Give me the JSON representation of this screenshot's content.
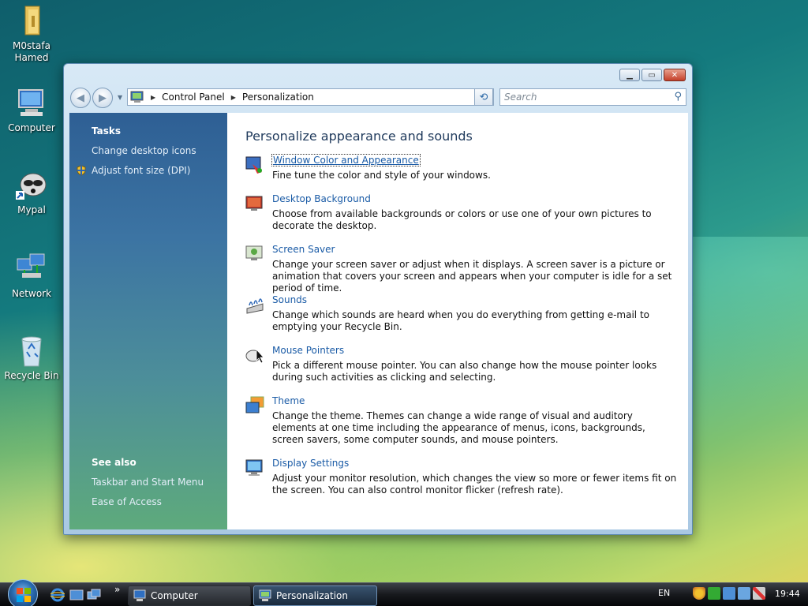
{
  "desktop": {
    "icons": [
      {
        "label": "M0stafa\nHamed",
        "icon": "folder-icon"
      },
      {
        "label": "Computer",
        "icon": "computer-icon"
      },
      {
        "label": "Mypal",
        "icon": "raccoon-shortcut-icon"
      },
      {
        "label": "Network",
        "icon": "network-icon"
      },
      {
        "label": "Recycle Bin",
        "icon": "recycle-bin-icon"
      }
    ]
  },
  "window": {
    "breadcrumb": [
      "Control Panel",
      "Personalization"
    ],
    "search_placeholder": "Search",
    "left_panel": {
      "tasks_heading": "Tasks",
      "tasks": [
        "Change desktop icons",
        "Adjust font size (DPI)"
      ],
      "see_also_heading": "See also",
      "see_also": [
        "Taskbar and Start Menu",
        "Ease of Access"
      ]
    },
    "main": {
      "heading": "Personalize appearance and sounds",
      "items": [
        {
          "title": "Window Color and Appearance",
          "desc": "Fine tune the color and style of your windows.",
          "icon": "window-color-icon"
        },
        {
          "title": "Desktop Background",
          "desc": "Choose from available backgrounds or colors or use one of your own pictures to decorate the desktop.",
          "icon": "desktop-background-icon"
        },
        {
          "title": "Screen Saver",
          "desc": "Change your screen saver or adjust when it displays. A screen saver is a picture or animation that covers your screen and appears when your computer is idle for a set period of time.",
          "icon": "screen-saver-icon"
        },
        {
          "title": "Sounds",
          "desc": "Change which sounds are heard when you do everything from getting e-mail to emptying your Recycle Bin.",
          "icon": "sounds-icon"
        },
        {
          "title": "Mouse Pointers",
          "desc": "Pick a different mouse pointer. You can also change how the mouse pointer looks during such activities as clicking and selecting.",
          "icon": "mouse-icon"
        },
        {
          "title": "Theme",
          "desc": "Change the theme. Themes can change a wide range of visual and auditory elements at one time including the appearance of menus, icons, backgrounds, screen savers, some computer sounds, and mouse pointers.",
          "icon": "theme-icon"
        },
        {
          "title": "Display Settings",
          "desc": "Adjust your monitor resolution, which changes the view so more or fewer items fit on the screen. You can also control monitor flicker (refresh rate).",
          "icon": "display-settings-icon"
        }
      ]
    }
  },
  "taskbar": {
    "buttons": [
      {
        "label": "Computer"
      },
      {
        "label": "Personalization"
      }
    ],
    "language": "EN",
    "time": "19:44",
    "overflow": "»"
  }
}
